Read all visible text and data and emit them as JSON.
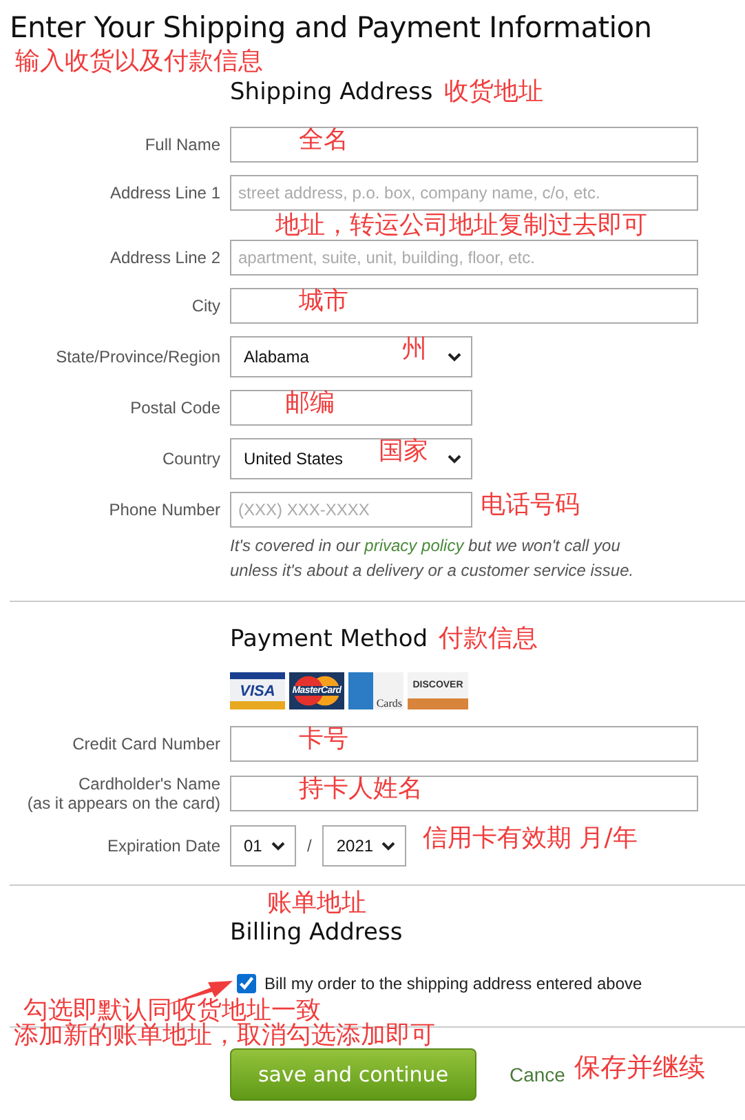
{
  "title": "Enter Your Shipping and Payment Information",
  "title_note": "输入收货以及付款信息",
  "shipping": {
    "heading": "Shipping Address",
    "heading_note": "收货地址",
    "fields": [
      {
        "kind": "text",
        "label": "Full Name",
        "note": "全名"
      },
      {
        "kind": "text",
        "label": "Address Line 1",
        "placeholder": "street address, p.o. box, company name, c/o, etc.",
        "note": "地址，转运公司地址复制过去即可"
      },
      {
        "kind": "text",
        "label": "Address Line 2",
        "placeholder": "apartment, suite, unit, building, floor, etc."
      },
      {
        "kind": "text",
        "label": "City",
        "note": "城市"
      },
      {
        "kind": "select",
        "label": "State/Province/Region",
        "value": "Alabama",
        "note": "州"
      },
      {
        "kind": "short",
        "label": "Postal Code",
        "note": "邮编"
      },
      {
        "kind": "select",
        "label": "Country",
        "value": "United States",
        "note": "国家"
      },
      {
        "kind": "short",
        "label": "Phone Number",
        "placeholder": "(XXX) XXX-XXXX",
        "note": "电话号码"
      }
    ],
    "privacy": {
      "before": "It's covered in our ",
      "link": "privacy policy",
      "after": " but we won't call you unless it's about a delivery or a customer service issue."
    }
  },
  "payment": {
    "heading": "Payment Method",
    "heading_note": "付款信息",
    "cards": [
      {
        "kind": "visa",
        "label": "VISA"
      },
      {
        "kind": "mastercard",
        "label": "MasterCard"
      },
      {
        "kind": "amex",
        "label": "Cards"
      },
      {
        "kind": "discover",
        "label": "DISCOVER"
      }
    ],
    "fields": [
      {
        "kind": "text",
        "label": "Credit Card Number",
        "note": "卡号"
      },
      {
        "kind": "text",
        "label": "Cardholder's Name",
        "sublabel": "(as it appears on the card)",
        "note": "持卡人姓名"
      },
      {
        "kind": "date",
        "label": "Expiration Date",
        "month": "01",
        "separator": "/",
        "year": "2021",
        "note": "信用卡有效期  月/年"
      }
    ]
  },
  "billing": {
    "heading_note": "账单地址",
    "heading": "Billing Address",
    "checkbox": {
      "label": "Bill my order to the shipping address entered above",
      "checked": true
    },
    "notes": [
      "勾选即默认同收货地址一致",
      "添加新的账单地址，取消勾选添加即可"
    ]
  },
  "actions": {
    "save": "save and continue",
    "cancel": "Cance",
    "note": "保存并继续"
  }
}
